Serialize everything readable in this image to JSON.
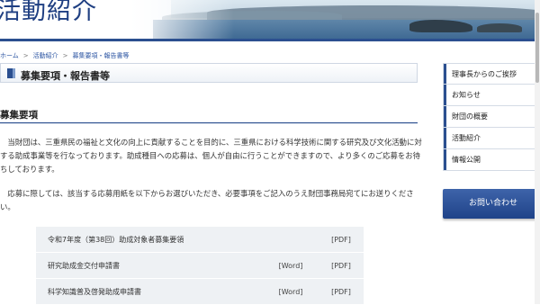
{
  "header": {
    "title": "活動紹介"
  },
  "breadcrumb": {
    "home": "ホーム",
    "activities": "活動紹介",
    "current": "募集要項・報告書等",
    "sep": ">"
  },
  "page_heading": "募集要項・報告書等",
  "section": {
    "heading": "募集要項",
    "paragraph1": "　当財団は、三重県民の福祉と文化の向上に貢献することを目的に、三重県における科学技術に関する研究及び文化活動に対する助成事業等を行なっております。助成種目への応募は、個人が自由に行うことができますので、より多くのご応募をお待ちしております。",
    "paragraph2": "　応募に際しては、該当する応募用紙を以下からお選びいただき、必要事項をご記入のうえ財団事務局宛てにお送りください。"
  },
  "documents": [
    {
      "name": "令和7年度（第38回）助成対象者募集要領",
      "word": "",
      "pdf": "[PDF]"
    },
    {
      "name": "研究助成金交付申請書",
      "word": "[Word]",
      "pdf": "[PDF]"
    },
    {
      "name": "科学知識普及啓発助成申請書",
      "word": "[Word]",
      "pdf": "[PDF]"
    }
  ],
  "sidebar": {
    "items": [
      {
        "label": "理事長からのご挨拶"
      },
      {
        "label": "お知らせ"
      },
      {
        "label": "財団の概要"
      },
      {
        "label": "活動紹介"
      },
      {
        "label": "情報公開"
      }
    ],
    "contact_label": "お問い合わせ"
  },
  "colors": {
    "brand": "#2b4f8f",
    "title": "#1f3f82",
    "table_row": "#eef1f4"
  }
}
